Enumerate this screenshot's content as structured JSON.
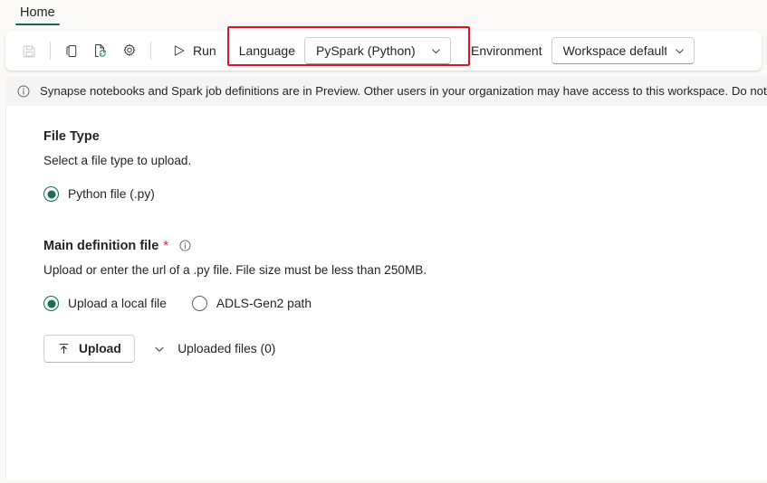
{
  "ribbon": {
    "tabs": [
      {
        "label": "Home",
        "active": true
      }
    ]
  },
  "toolbar": {
    "buttons": [
      {
        "name": "save-icon",
        "title": "Save",
        "disabled": true
      },
      {
        "name": "copy-icon",
        "title": "Copy",
        "disabled": false
      },
      {
        "name": "refresh-document-icon",
        "title": "Refresh",
        "disabled": false
      },
      {
        "name": "settings-gear-icon",
        "title": "Settings",
        "disabled": false
      }
    ],
    "run_label": "Run",
    "language": {
      "label": "Language",
      "value": "PySpark (Python)"
    },
    "environment": {
      "label": "Environment",
      "value": "Workspace default"
    },
    "highlight_color": "#e81123"
  },
  "banner": {
    "icon": "info-icon",
    "text": "Synapse notebooks and Spark job definitions are in Preview. Other users in your organization may have access to this workspace. Do not use these items"
  },
  "file_type": {
    "title": "File Type",
    "description": "Select a file type to upload.",
    "options": [
      {
        "label": "Python file (.py)",
        "selected": true
      }
    ]
  },
  "main_definition": {
    "title": "Main definition file",
    "required_marker": "*",
    "info_icon": "info-icon",
    "description": "Upload or enter the url of a .py file. File size must be less than 250MB.",
    "source_options": [
      {
        "label": "Upload a local file",
        "selected": true
      },
      {
        "label": "ADLS-Gen2 path",
        "selected": false
      }
    ],
    "upload_button_label": "Upload",
    "upload_icon": "upload-icon",
    "uploaded_files_label": "Uploaded files (0)",
    "accordion_icon": "chevron-down-icon"
  },
  "theme": {
    "accent": "#0f6c52",
    "required": "#c4314b",
    "page_bg": "#faf9f8",
    "content_bg": "#ffffff",
    "banner_bg": "#f4f4f4"
  }
}
